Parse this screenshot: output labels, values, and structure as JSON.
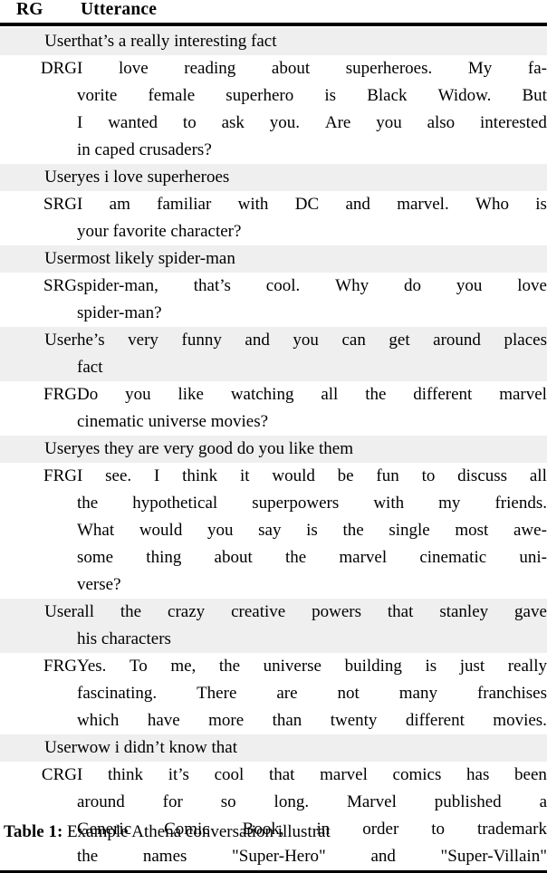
{
  "table": {
    "columns": [
      "RG",
      "Utterance"
    ],
    "shaded_color": "#efefef",
    "rows": [
      {
        "rg": "User",
        "shaded": true,
        "lines": [
          {
            "text": "that’s a really interesting fact",
            "justify": false
          }
        ]
      },
      {
        "rg": "DRG",
        "shaded": false,
        "lines": [
          {
            "text": "I love reading about superheroes.   My fa-",
            "justify": true,
            "words": [
              "I",
              "love",
              "reading",
              "about",
              "superheroes.",
              "My",
              "fa-"
            ]
          },
          {
            "text": "vorite female superhero is Black Widow. But",
            "justify": true,
            "words": [
              "vorite",
              "female",
              "superhero",
              "is",
              "Black",
              "Widow.",
              "But"
            ]
          },
          {
            "text": "I wanted to ask you. Are you also interested",
            "justify": true,
            "words": [
              "I",
              "wanted",
              "to",
              "ask",
              "you.",
              "Are",
              "you",
              "also",
              "interested"
            ]
          },
          {
            "text": "in caped crusaders?",
            "justify": false
          }
        ]
      },
      {
        "rg": "User",
        "shaded": true,
        "lines": [
          {
            "text": "yes i love superheroes",
            "justify": false
          }
        ]
      },
      {
        "rg": "SRG",
        "shaded": false,
        "lines": [
          {
            "text": "I am familiar with DC and marvel. Who is",
            "justify": true,
            "words": [
              "I",
              "am",
              "familiar",
              "with",
              "DC",
              "and",
              "marvel.",
              "Who",
              "is"
            ]
          },
          {
            "text": "your favorite character?",
            "justify": false
          }
        ]
      },
      {
        "rg": "User",
        "shaded": true,
        "lines": [
          {
            "text": "most likely spider-man",
            "justify": false
          }
        ]
      },
      {
        "rg": "SRG",
        "shaded": false,
        "lines": [
          {
            "text": "spider-man, that’s cool.  Why do you love",
            "justify": true,
            "words": [
              "spider-man,",
              "that’s",
              "cool.",
              "Why",
              "do",
              "you",
              "love"
            ]
          },
          {
            "text": "spider-man?",
            "justify": false
          }
        ]
      },
      {
        "rg": "User",
        "shaded": true,
        "lines": [
          {
            "text": "he’s very funny and you can get around places",
            "justify": true,
            "words": [
              "he’s",
              "very",
              "funny",
              "and",
              "you",
              "can",
              "get",
              "around",
              "places"
            ]
          },
          {
            "text": "fact",
            "justify": false
          }
        ]
      },
      {
        "rg": "FRG",
        "shaded": false,
        "lines": [
          {
            "text": "Do you like watching all the different marvel",
            "justify": true,
            "words": [
              "Do",
              "you",
              "like",
              "watching",
              "all",
              "the",
              "different",
              "marvel"
            ]
          },
          {
            "text": "cinematic universe movies?",
            "justify": false
          }
        ]
      },
      {
        "rg": "User",
        "shaded": true,
        "lines": [
          {
            "text": "yes they are very good do you like them",
            "justify": false
          }
        ]
      },
      {
        "rg": "FRG",
        "shaded": false,
        "lines": [
          {
            "text": "I see.  I think it would be fun to discuss all",
            "justify": true,
            "words": [
              "I",
              "see.",
              "I",
              "think",
              "it",
              "would",
              "be",
              "fun",
              "to",
              "discuss",
              "all"
            ]
          },
          {
            "text": "the hypothetical superpowers with my friends.",
            "justify": true,
            "words": [
              "the",
              "hypothetical",
              "superpowers",
              "with",
              "my",
              "friends."
            ]
          },
          {
            "text": "What would you say is the single most awe-",
            "justify": true,
            "words": [
              "What",
              "would",
              "you",
              "say",
              "is",
              "the",
              "single",
              "most",
              "awe-"
            ]
          },
          {
            "text": "some thing about the marvel cinematic uni-",
            "justify": true,
            "words": [
              "some",
              "thing",
              "about",
              "the",
              "marvel",
              "cinematic",
              "uni-"
            ]
          },
          {
            "text": "verse?",
            "justify": false
          }
        ]
      },
      {
        "rg": "User",
        "shaded": true,
        "lines": [
          {
            "text": "all the crazy creative powers that stanley gave",
            "justify": true,
            "words": [
              "all",
              "the",
              "crazy",
              "creative",
              "powers",
              "that",
              "stanley",
              "gave"
            ]
          },
          {
            "text": "his characters",
            "justify": false
          }
        ]
      },
      {
        "rg": "FRG",
        "shaded": false,
        "lines": [
          {
            "text": "Yes. To me, the universe building is just really",
            "justify": true,
            "words": [
              "Yes.",
              "To",
              "me,",
              "the",
              "universe",
              "building",
              "is",
              "just",
              "really"
            ]
          },
          {
            "text": "fascinating.  There are not many franchises",
            "justify": true,
            "words": [
              "fascinating.",
              "There",
              "are",
              "not",
              "many",
              "franchises"
            ]
          },
          {
            "text": "which have more than twenty different movies.",
            "justify": true,
            "words": [
              "which",
              "have",
              "more",
              "than",
              "twenty",
              "different",
              "movies."
            ]
          }
        ]
      },
      {
        "rg": "User",
        "shaded": true,
        "lines": [
          {
            "text": "wow i didn’t know that",
            "justify": false
          }
        ]
      },
      {
        "rg": "CRG",
        "shaded": false,
        "lines": [
          {
            "text": "I think it’s cool that marvel comics has been",
            "justify": true,
            "words": [
              "I",
              "think",
              "it’s",
              "cool",
              "that",
              "marvel",
              "comics",
              "has",
              "been"
            ]
          },
          {
            "text": "around for so long.   Marvel published a",
            "justify": true,
            "words": [
              "around",
              "for",
              "so",
              "long.",
              "Marvel",
              "published",
              "a"
            ]
          },
          {
            "text": "Generic Comic Book, in order to trademark",
            "justify": true,
            "words": [
              "Generic",
              "Comic",
              "Book,",
              "in",
              "order",
              "to",
              "trademark"
            ]
          },
          {
            "text": "the names \"Super-Hero\" and \"Super-Villain\"",
            "justify": true,
            "words": [
              "the",
              "names",
              "\"Super-Hero\"",
              "and",
              "\"Super-Villain\""
            ]
          }
        ]
      }
    ]
  },
  "caption": {
    "label": "Table 1:",
    "text": "Example Athena conversation illustrat"
  }
}
